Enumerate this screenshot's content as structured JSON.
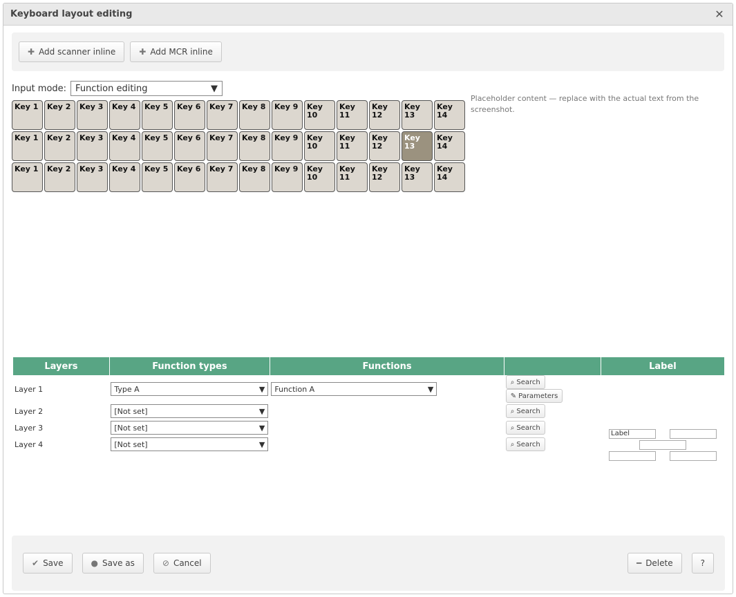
{
  "window": {
    "title": "Keyboard layout editing",
    "close_icon": "close-icon"
  },
  "toolbar": {
    "add_scanner_label": "Add scanner inline",
    "add_mcr_label": "Add MCR inline"
  },
  "mode": {
    "label": "Input mode:",
    "value": "Function editing"
  },
  "keyboard": {
    "rows": [
      [
        {
          "t": "Key 1"
        },
        {
          "t": "Key 2"
        },
        {
          "t": "Key 3"
        },
        {
          "t": "Key 4"
        },
        {
          "t": "Key 5"
        },
        {
          "t": "Key 6"
        },
        {
          "t": "Key 7"
        },
        {
          "t": "Key 8"
        },
        {
          "t": "Key 9"
        },
        {
          "t": "Key 10"
        },
        {
          "t": "Key 11"
        },
        {
          "t": "Key 12"
        },
        {
          "t": "Key 13"
        },
        {
          "t": "Key 14"
        }
      ],
      [
        {
          "t": "Key 1"
        },
        {
          "t": "Key 2"
        },
        {
          "t": "Key 3"
        },
        {
          "t": "Key 4"
        },
        {
          "t": "Key 5"
        },
        {
          "t": "Key 6"
        },
        {
          "t": "Key 7"
        },
        {
          "t": "Key 8"
        },
        {
          "t": "Key 9"
        },
        {
          "t": "Key 10"
        },
        {
          "t": "Key 11"
        },
        {
          "t": "Key 12"
        },
        {
          "t": "Key 13",
          "active": true
        },
        {
          "t": "Key 14"
        }
      ],
      [
        {
          "t": "Key 1"
        },
        {
          "t": "Key 2"
        },
        {
          "t": "Key 3"
        },
        {
          "t": "Key 4"
        },
        {
          "t": "Key 5"
        },
        {
          "t": "Key 6"
        },
        {
          "t": "Key 7"
        },
        {
          "t": "Key 8"
        },
        {
          "t": "Key 9"
        },
        {
          "t": "Key 10"
        },
        {
          "t": "Key 11"
        },
        {
          "t": "Key 12"
        },
        {
          "t": "Key 13"
        },
        {
          "t": "Key 14"
        }
      ]
    ]
  },
  "table": {
    "headers": [
      "Layers",
      "Function types",
      "Functions",
      "",
      "Label"
    ],
    "rows": [
      {
        "layer": "Layer 1",
        "type": "Type A",
        "function": "Function A",
        "search": "Search",
        "params": "Parameters"
      },
      {
        "layer": "Layer 2",
        "type": "[Not set]",
        "search": "Search"
      },
      {
        "layer": "Layer 3",
        "type": "[Not set]",
        "search": "Search"
      },
      {
        "layer": "Layer 4",
        "type": "[Not set]",
        "search": "Search"
      }
    ]
  },
  "label": {
    "fields": [
      "Label",
      "",
      "",
      "",
      ""
    ]
  },
  "footer": {
    "save_label": "Save",
    "save_as_label": "Save as",
    "cancel_label": "Cancel",
    "delete_label": "Delete",
    "help_label": "?"
  },
  "notice": "Placeholder content — replace with the actual text from the screenshot."
}
